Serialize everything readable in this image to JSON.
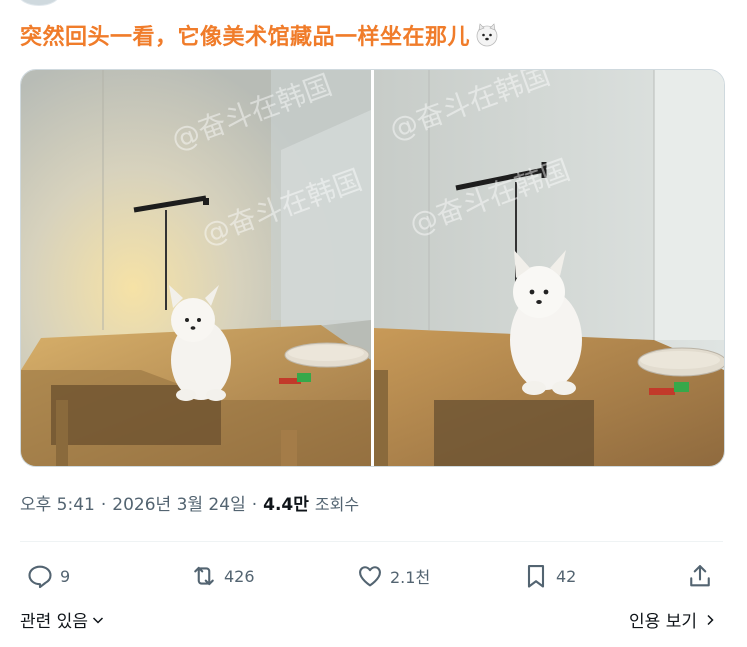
{
  "tweet": {
    "headline": "突然回头一看，它像美术馆藏品一样坐在那儿",
    "watermark": "@奋斗在韩国",
    "time": "오후 5:41",
    "date": "2026년 3월 24일",
    "views_count": "4.4만",
    "views_label": "조회수"
  },
  "actions": {
    "reply_count": "9",
    "retweet_count": "426",
    "like_count": "2.1천",
    "bookmark_count": "42"
  },
  "footer": {
    "related_label": "관련 있음",
    "quote_label": "인용 보기"
  },
  "colors": {
    "headline": "#f07c2a",
    "secondary_text": "#536471",
    "primary_text": "#0f1419"
  },
  "icons": [
    "dog-face-emoji-icon",
    "reply-icon",
    "retweet-icon",
    "like-icon",
    "bookmark-icon",
    "share-icon",
    "chevron-down-icon",
    "chevron-right-icon"
  ]
}
